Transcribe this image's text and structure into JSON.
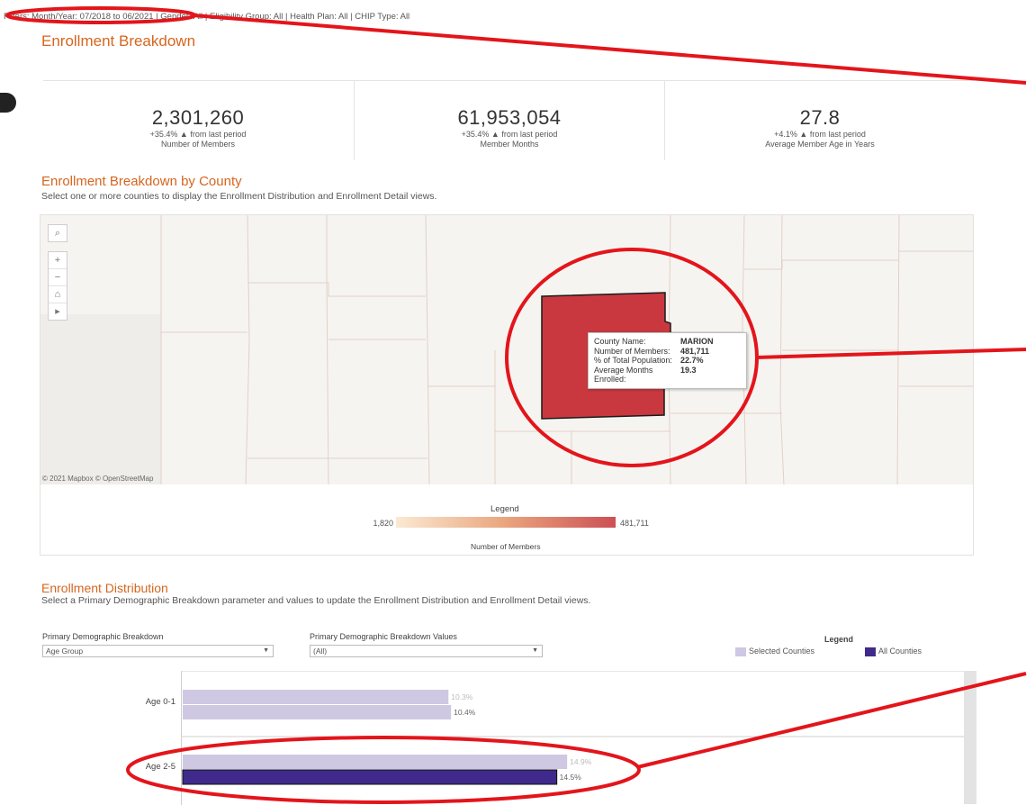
{
  "filters": {
    "text": "Filters: Month/Year: 07/2018 to 06/2021 | Gender: All | Eligibility Group: All | Health Plan: All | CHIP Type: All"
  },
  "page_title": "Enrollment Breakdown",
  "kpis": [
    {
      "value": "2,301,260",
      "change": "+35.4% ▲ from last period",
      "label": "Number of Members"
    },
    {
      "value": "61,953,054",
      "change": "+35.4% ▲ from last period",
      "label": "Member Months"
    },
    {
      "value": "27.8",
      "change": "+4.1% ▲ from last period",
      "label": "Average Member Age in Years"
    }
  ],
  "county_section": {
    "title": "Enrollment Breakdown by County",
    "subtitle": "Select one or more counties to display the Enrollment Distribution and Enrollment Detail views."
  },
  "map": {
    "credit": "© 2021 Mapbox © OpenStreetMap",
    "selected_color": "#c9383f",
    "tools": {
      "search": "⌕",
      "zoom_in": "+",
      "zoom_out": "−",
      "home": "⌂",
      "play": "▸"
    },
    "tooltip": {
      "rows": [
        {
          "key": "County Name:",
          "value": "MARION"
        },
        {
          "key": "Number of Members:",
          "value": "481,711"
        },
        {
          "key": "% of Total Population:",
          "value": "22.7%"
        },
        {
          "key": "Average Months Enrolled:",
          "value": "19.3"
        }
      ]
    },
    "legend": {
      "title": "Legend",
      "min": "1,820",
      "max": "481,711",
      "caption": "Number of Members"
    }
  },
  "distribution": {
    "title": "Enrollment Distribution",
    "subtitle": "Select a Primary Demographic Breakdown parameter and values to update the Enrollment Distribution and Enrollment Detail views.",
    "primary_label": "Primary Demographic Breakdown",
    "primary_value": "Age Group",
    "values_label": "Primary Demographic Breakdown Values",
    "values_value": "(All)",
    "legend_title": "Legend",
    "legend_items": [
      {
        "label": "Selected Counties",
        "color": "#cfc8e3"
      },
      {
        "label": "All Counties",
        "color": "#3f2a8c"
      }
    ]
  },
  "chart_data": {
    "type": "bar",
    "categories": [
      "Age 0-1",
      "Age 2-5"
    ],
    "series": [
      {
        "name": "Selected Counties",
        "values": [
          10.3,
          14.9
        ],
        "labels": [
          "10.3%",
          "14.9%"
        ]
      },
      {
        "name": "All Counties",
        "values": [
          10.4,
          14.5
        ],
        "labels": [
          "10.4%",
          "14.5%"
        ]
      }
    ],
    "x_max": 30
  }
}
